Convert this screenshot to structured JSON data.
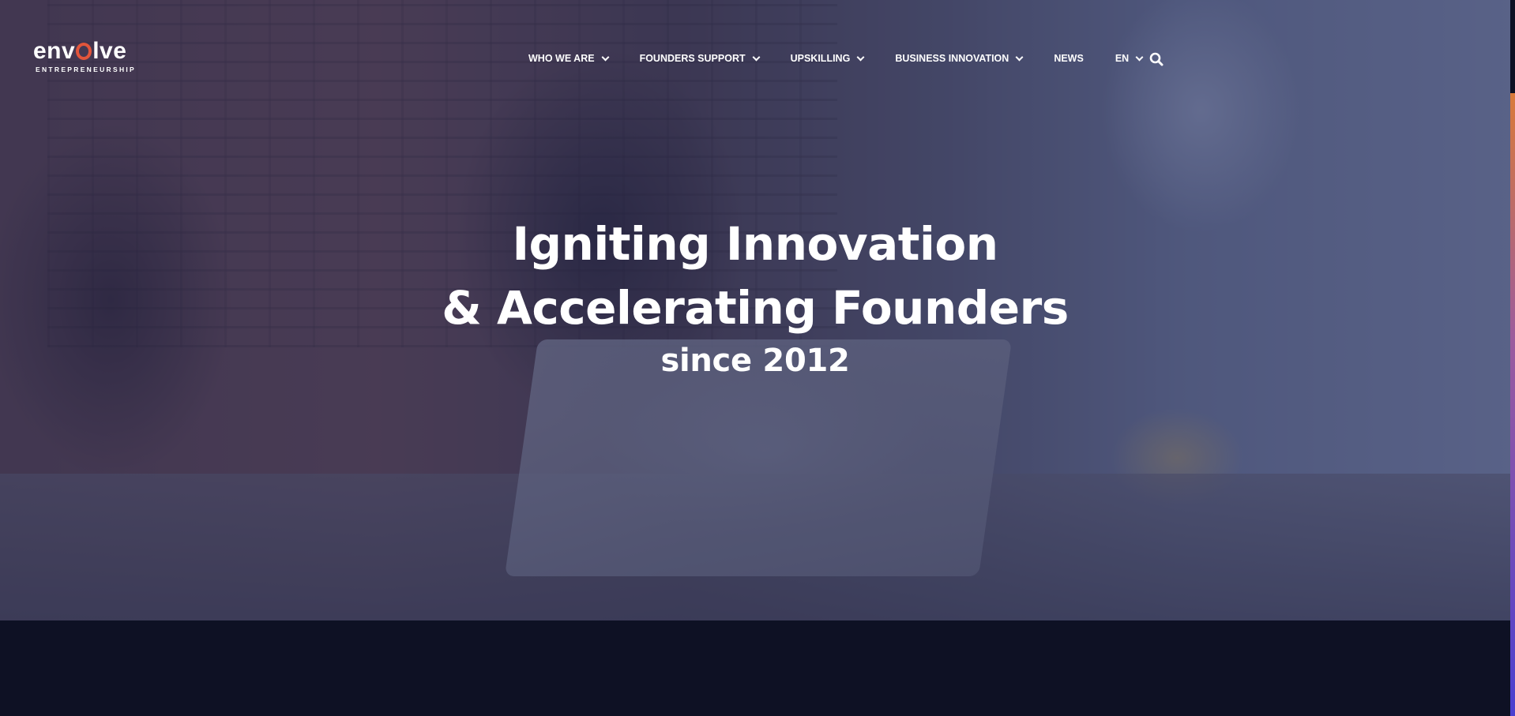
{
  "logo": {
    "word_before": "env",
    "word_after": "lve",
    "tagline": "ENTREPRENEURSHIP"
  },
  "nav": {
    "items": [
      {
        "label": "WHO WE ARE",
        "has_dropdown": true
      },
      {
        "label": "FOUNDERS SUPPORT",
        "has_dropdown": true
      },
      {
        "label": "UPSKILLING",
        "has_dropdown": true
      },
      {
        "label": "BUSINESS INNOVATION",
        "has_dropdown": true
      },
      {
        "label": "NEWS",
        "has_dropdown": false
      },
      {
        "label": "EN",
        "has_dropdown": true
      }
    ],
    "search_icon": "search-icon"
  },
  "hero": {
    "headline_line1": "Igniting Innovation",
    "headline_line2": "& Accelerating Founders",
    "subline": "since 2012"
  },
  "colors": {
    "accent_orange": "#e2553b",
    "dark_background": "#0e1124",
    "overlay": "#202854"
  }
}
